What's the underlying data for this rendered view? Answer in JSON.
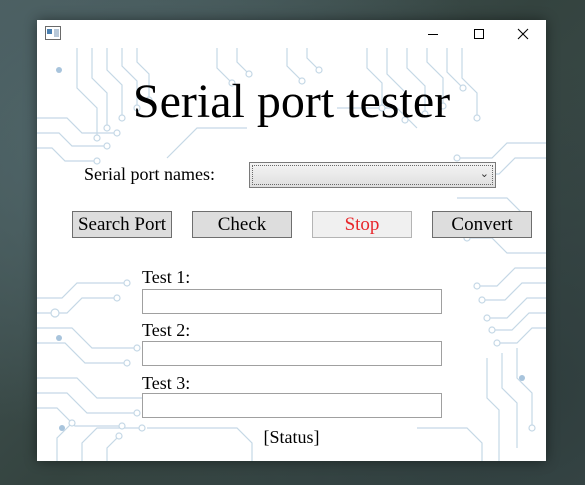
{
  "window": {
    "close_symbol": "✕"
  },
  "main": {
    "title": "Serial port tester",
    "serial_port_label": "Serial port names:",
    "serial_port_value": "",
    "buttons": {
      "search_port": "Search Port",
      "check": "Check",
      "stop": "Stop",
      "convert": "Convert"
    },
    "tests": [
      {
        "label": "Test 1:",
        "value": ""
      },
      {
        "label": "Test 2:",
        "value": ""
      },
      {
        "label": "Test 3:",
        "value": ""
      }
    ],
    "status": "[Status]"
  },
  "colors": {
    "stop_text": "#e8262a",
    "circuit": "#c5d8e6"
  },
  "icons": [
    "app-icon",
    "minimize-icon",
    "maximize-icon",
    "close-icon",
    "chevron-down-icon"
  ]
}
